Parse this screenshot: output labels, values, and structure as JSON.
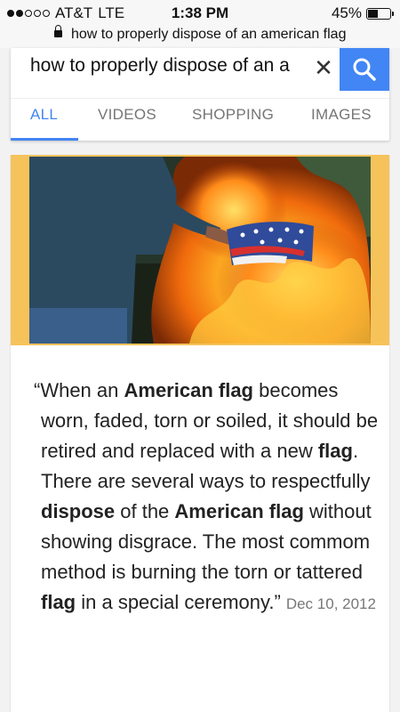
{
  "status_bar": {
    "carrier": "AT&T",
    "network": "LTE",
    "time": "1:38 PM",
    "battery_percent": "45%",
    "battery_level": 0.45,
    "signal_bars": 2
  },
  "url_bar": {
    "text": "how to properly dispose of an american flag"
  },
  "search": {
    "query": "how to properly dispose of an a",
    "clear_icon": "close-icon",
    "search_icon": "search-icon",
    "accent_color": "#4285f4"
  },
  "tabs": [
    {
      "label": "ALL",
      "active": true
    },
    {
      "label": "VIDEOS",
      "active": false
    },
    {
      "label": "SHOPPING",
      "active": false
    },
    {
      "label": "IMAGES",
      "active": false
    }
  ],
  "featured_snippet": {
    "image_frame_color": "#f6c35a",
    "quote_segments": [
      {
        "text": "“When an ",
        "bold": false
      },
      {
        "text": "American flag",
        "bold": true
      },
      {
        "text": " becomes worn, faded, torn or soiled, it should be retired and replaced with a new ",
        "bold": false
      },
      {
        "text": "flag",
        "bold": true
      },
      {
        "text": ". There are several ways to respectfully ",
        "bold": false
      },
      {
        "text": "dispose",
        "bold": true
      },
      {
        "text": " of the ",
        "bold": false
      },
      {
        "text": "American flag",
        "bold": true
      },
      {
        "text": " without showing disgrace. The most commom method is burning the torn or tattered ",
        "bold": false
      },
      {
        "text": "flag",
        "bold": true
      },
      {
        "text": " in a special ceremony.”",
        "bold": false
      }
    ],
    "date": "Dec 10, 2012"
  }
}
